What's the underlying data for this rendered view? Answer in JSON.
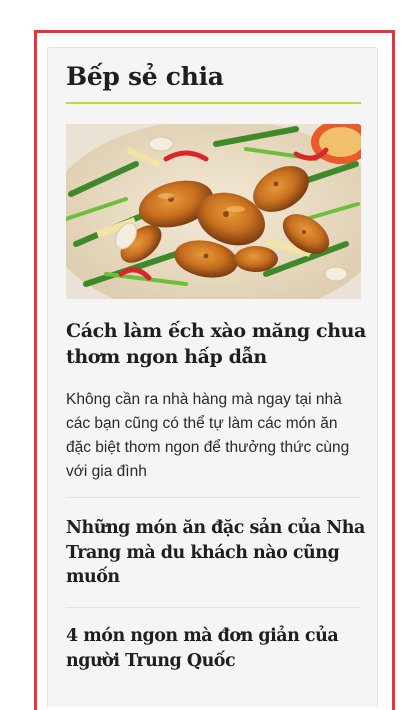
{
  "widget": {
    "title": "Bếp sẻ chia",
    "accent_color": "#c6d63a",
    "frame_color": "#e8333c"
  },
  "featured": {
    "image_alt": "Món ếch xào măng chua",
    "title": "Cách làm ếch xào măng chua thơm ngon hấp dẫn",
    "description": "Không cần ra nhà hàng mà ngay tại nhà các bạn cũng có thể tự làm các món ăn đặc biệt thơm ngon để thưởng thức cùng với gia đình"
  },
  "articles": [
    {
      "title": "Những món ăn đặc sản của Nha Trang mà du khách nào cũng muốn"
    },
    {
      "title": "4 món ngon mà đơn giản của người Trung Quốc"
    }
  ]
}
